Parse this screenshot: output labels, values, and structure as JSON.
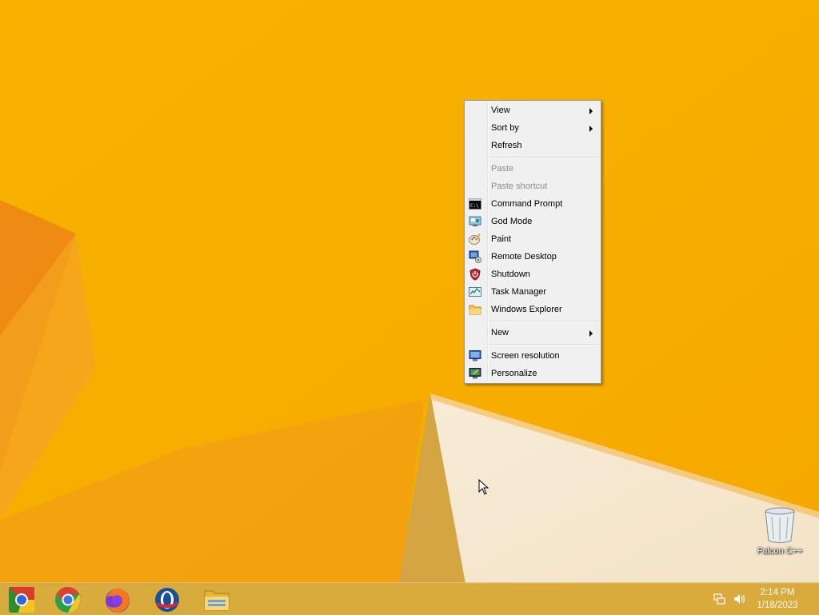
{
  "context_menu": {
    "items": [
      {
        "label": "View",
        "submenu": true
      },
      {
        "label": "Sort by",
        "submenu": true
      },
      {
        "label": "Refresh"
      },
      {
        "label": "Paste",
        "disabled": true
      },
      {
        "label": "Paste shortcut",
        "disabled": true
      },
      {
        "label": "Command Prompt",
        "icon": "command-prompt-icon"
      },
      {
        "label": "God Mode",
        "icon": "control-panel-icon"
      },
      {
        "label": "Paint",
        "icon": "paint-palette-icon"
      },
      {
        "label": "Remote Desktop",
        "icon": "remote-desktop-icon"
      },
      {
        "label": "Shutdown",
        "icon": "shield-shutdown-icon"
      },
      {
        "label": "Task Manager",
        "icon": "task-manager-icon"
      },
      {
        "label": "Windows Explorer",
        "icon": "folder-icon"
      },
      {
        "label": "New",
        "submenu": true
      },
      {
        "label": "Screen resolution",
        "icon": "monitor-icon"
      },
      {
        "label": "Personalize",
        "icon": "personalize-icon"
      }
    ]
  },
  "desktop": {
    "recycle_bin_label": "Falcon C++",
    "recycle_bin_icon": "recycle-bin-icon"
  },
  "taskbar": {
    "pinned": [
      {
        "name": "chromium-icon"
      },
      {
        "name": "chrome-icon"
      },
      {
        "name": "firefox-icon"
      },
      {
        "name": "opera-icon"
      },
      {
        "name": "file-explorer-icon"
      }
    ],
    "tray": {
      "network_icon": "network-icon",
      "volume_icon": "volume-icon",
      "time": "2:14 PM",
      "date": "1/18/2023"
    }
  },
  "colors": {
    "wallpaper": "#f6b400",
    "menu_bg": "#f0f0f0",
    "taskbar": "#d4aa46"
  }
}
